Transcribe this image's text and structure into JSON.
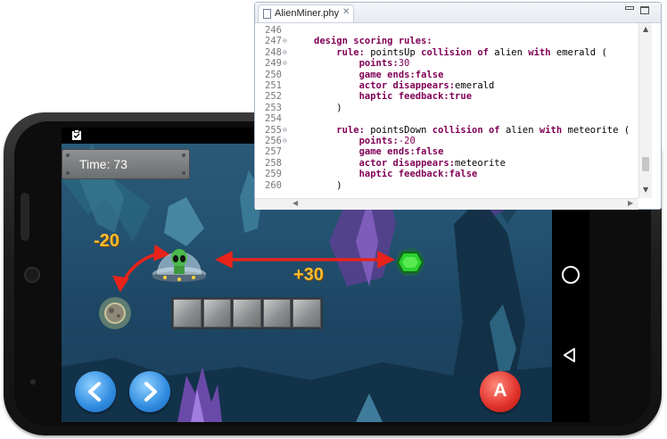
{
  "editor": {
    "tab_title": "AlienMiner.phy",
    "tab_close": "✕",
    "lines": [
      {
        "num": "246",
        "fold": false,
        "indent": "",
        "parts": []
      },
      {
        "num": "247",
        "fold": true,
        "indent": "",
        "parts": [
          {
            "t": "design scoring rules:",
            "c": "kw"
          }
        ]
      },
      {
        "num": "248",
        "fold": true,
        "indent": "    ",
        "parts": [
          {
            "t": "rule:",
            "c": "kw"
          },
          {
            "t": " pointsUp ",
            "c": ""
          },
          {
            "t": "collision of",
            "c": "kw"
          },
          {
            "t": " alien ",
            "c": ""
          },
          {
            "t": "with",
            "c": "kw"
          },
          {
            "t": " emerald (",
            "c": ""
          }
        ]
      },
      {
        "num": "249",
        "fold": true,
        "indent": "        ",
        "parts": [
          {
            "t": "points:",
            "c": "kw"
          },
          {
            "t": "30",
            "c": "num"
          }
        ]
      },
      {
        "num": "250",
        "fold": false,
        "indent": "        ",
        "parts": [
          {
            "t": "game ends:",
            "c": "kw"
          },
          {
            "t": "false",
            "c": "kw"
          }
        ]
      },
      {
        "num": "251",
        "fold": false,
        "indent": "        ",
        "parts": [
          {
            "t": "actor disappears:",
            "c": "kw"
          },
          {
            "t": "emerald",
            "c": ""
          }
        ]
      },
      {
        "num": "252",
        "fold": false,
        "indent": "        ",
        "parts": [
          {
            "t": "haptic feedback:",
            "c": "kw"
          },
          {
            "t": "true",
            "c": "kw"
          }
        ]
      },
      {
        "num": "253",
        "fold": false,
        "indent": "    ",
        "parts": [
          {
            "t": ")",
            "c": ""
          }
        ]
      },
      {
        "num": "254",
        "fold": false,
        "indent": "",
        "parts": []
      },
      {
        "num": "255",
        "fold": true,
        "indent": "    ",
        "parts": [
          {
            "t": "rule:",
            "c": "kw"
          },
          {
            "t": " pointsDown ",
            "c": ""
          },
          {
            "t": "collision of",
            "c": "kw"
          },
          {
            "t": " alien ",
            "c": ""
          },
          {
            "t": "with",
            "c": "kw"
          },
          {
            "t": " meteorite (",
            "c": ""
          }
        ]
      },
      {
        "num": "256",
        "fold": true,
        "indent": "        ",
        "parts": [
          {
            "t": "points:",
            "c": "kw"
          },
          {
            "t": "-20",
            "c": "num"
          }
        ]
      },
      {
        "num": "257",
        "fold": false,
        "indent": "        ",
        "parts": [
          {
            "t": "game ends:",
            "c": "kw"
          },
          {
            "t": "false",
            "c": "kw"
          }
        ]
      },
      {
        "num": "258",
        "fold": false,
        "indent": "        ",
        "parts": [
          {
            "t": "actor disappears:",
            "c": "kw"
          },
          {
            "t": "meteorite",
            "c": ""
          }
        ]
      },
      {
        "num": "259",
        "fold": false,
        "indent": "        ",
        "parts": [
          {
            "t": "haptic feedback:",
            "c": "kw"
          },
          {
            "t": "false",
            "c": "kw"
          }
        ]
      },
      {
        "num": "260",
        "fold": false,
        "indent": "    ",
        "parts": [
          {
            "t": ")",
            "c": ""
          }
        ]
      }
    ]
  },
  "game": {
    "timer_text": "Time: 73",
    "score_negative": "-20",
    "score_positive": "+30",
    "action_button": "A",
    "block_count": 5
  },
  "colors": {
    "keyword": "#7f0055",
    "score_text": "#ffbd2e",
    "arrow_red": "#e8231b",
    "emerald_green": "#2bd12e",
    "nav_background": "#000000"
  },
  "icons": {
    "status": "clipboard-check-icon",
    "nav_home": "circle-home-icon",
    "nav_back": "triangle-back-icon",
    "left": "arrow-left-icon",
    "right": "arrow-right-icon"
  }
}
